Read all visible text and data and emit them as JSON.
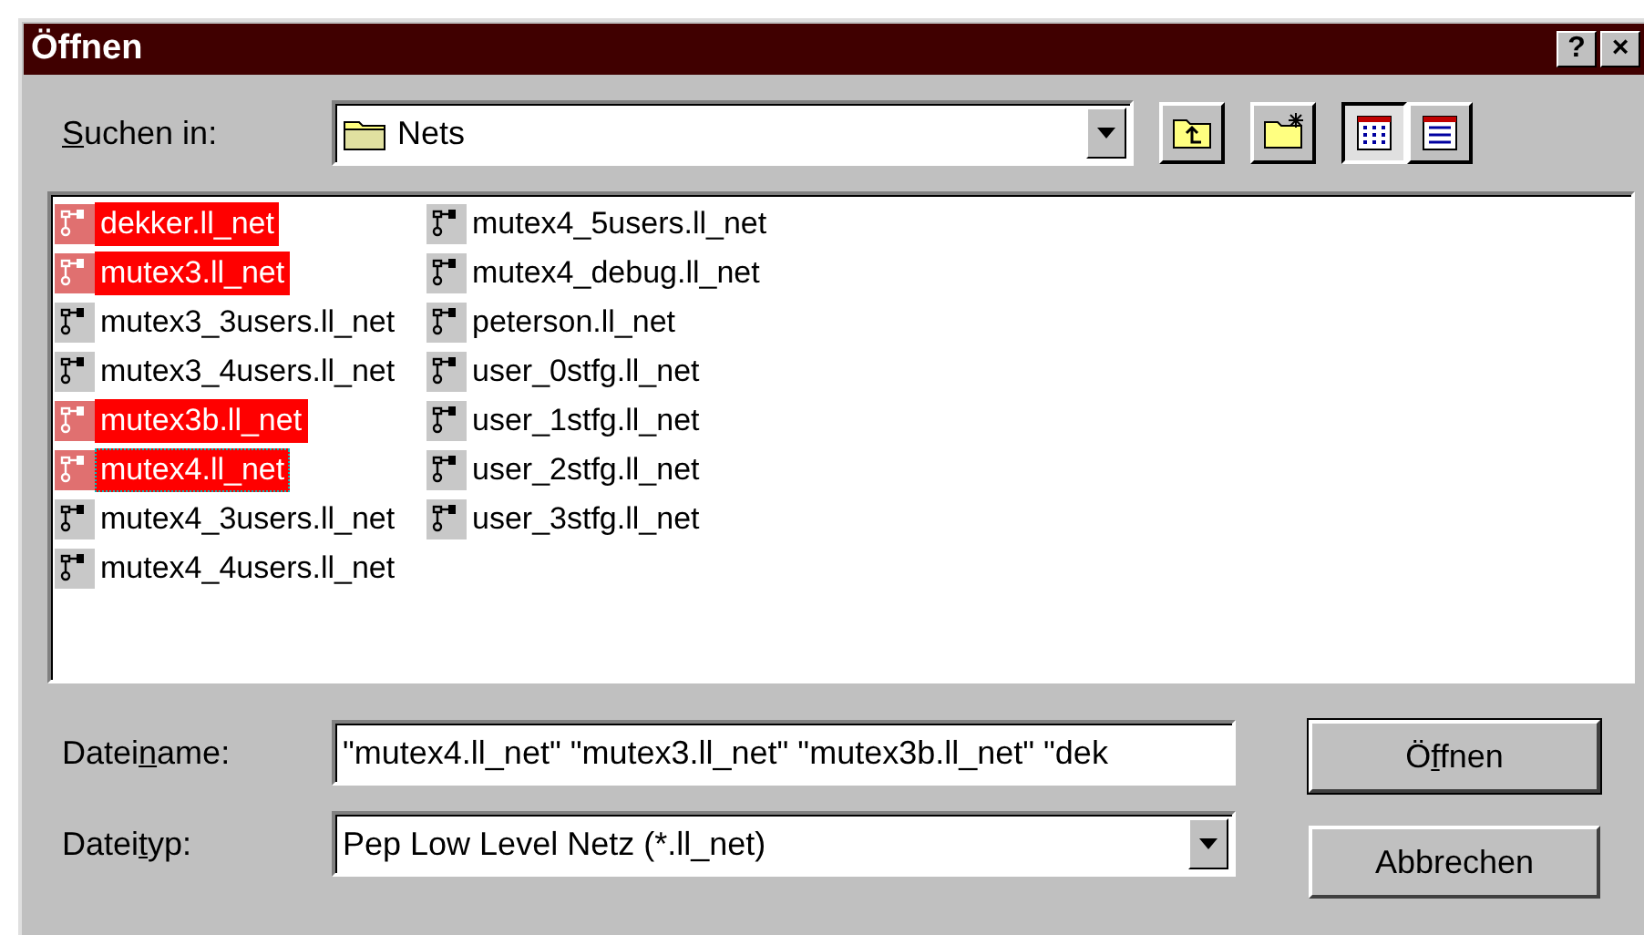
{
  "window": {
    "title": "Öffnen",
    "title_buttons": [
      "?",
      "×"
    ]
  },
  "look_in": {
    "label_parts": {
      "key": "S",
      "after": "uchen in:"
    },
    "value": "Nets"
  },
  "toolbar": [
    {
      "kind": "up"
    },
    {
      "kind": "newfolder"
    },
    {
      "kind": "list",
      "selected": true
    },
    {
      "kind": "details",
      "selected": false
    }
  ],
  "files": [
    {
      "name": "dekker.ll_net",
      "selected": true,
      "focused": false
    },
    {
      "name": "mutex3.ll_net",
      "selected": true,
      "focused": false
    },
    {
      "name": "mutex3_3users.ll_net",
      "selected": false,
      "focused": false
    },
    {
      "name": "mutex3_4users.ll_net",
      "selected": false,
      "focused": false
    },
    {
      "name": "mutex3b.ll_net",
      "selected": true,
      "focused": false
    },
    {
      "name": "mutex4.ll_net",
      "selected": true,
      "focused": true
    },
    {
      "name": "mutex4_3users.ll_net",
      "selected": false,
      "focused": false
    },
    {
      "name": "mutex4_4users.ll_net",
      "selected": false,
      "focused": false
    },
    {
      "name": "mutex4_5users.ll_net",
      "selected": false,
      "focused": false
    },
    {
      "name": "mutex4_debug.ll_net",
      "selected": false,
      "focused": false
    },
    {
      "name": "peterson.ll_net",
      "selected": false,
      "focused": false
    },
    {
      "name": "user_0stfg.ll_net",
      "selected": false,
      "focused": false
    },
    {
      "name": "user_1stfg.ll_net",
      "selected": false,
      "focused": false
    },
    {
      "name": "user_2stfg.ll_net",
      "selected": false,
      "focused": false
    },
    {
      "name": "user_3stfg.ll_net",
      "selected": false,
      "focused": false
    }
  ],
  "filename": {
    "label_parts": {
      "before": "Datei",
      "key": "n",
      "after": "ame:"
    },
    "value": "\"mutex4.ll_net\" \"mutex3.ll_net\" \"mutex3b.ll_net\" \"dek"
  },
  "filetype": {
    "label_parts": {
      "before": "Datei",
      "key": "t",
      "after": "yp:"
    },
    "value": "Pep Low Level Netz (*.ll_net)"
  },
  "buttons": [
    {
      "label_parts": {
        "before": "Ö",
        "key": "f",
        "after": "fnen"
      },
      "default": true
    },
    {
      "label_parts": {
        "before": "Abbrechen"
      },
      "default": false
    }
  ]
}
